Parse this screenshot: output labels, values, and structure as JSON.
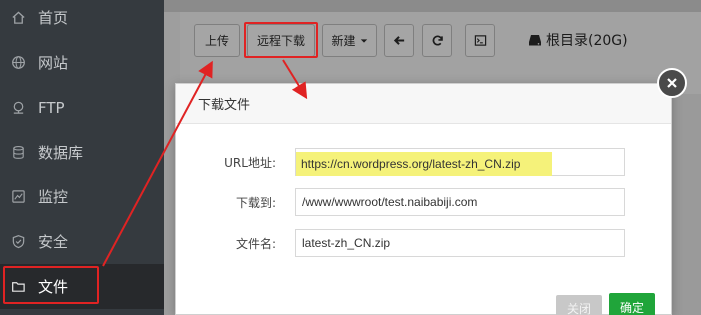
{
  "sidebar": {
    "items": [
      {
        "label": "首页",
        "icon": "home-icon"
      },
      {
        "label": "网站",
        "icon": "globe-icon"
      },
      {
        "label": "FTP",
        "icon": "ftp-icon"
      },
      {
        "label": "数据库",
        "icon": "database-icon"
      },
      {
        "label": "监控",
        "icon": "monitor-icon"
      },
      {
        "label": "安全",
        "icon": "shield-icon"
      },
      {
        "label": "文件",
        "icon": "folder-icon",
        "active": true
      }
    ]
  },
  "toolbar": {
    "upload_label": "上传",
    "remote_download_label": "远程下载",
    "new_label": "新建",
    "root_label": "根目录(20G)"
  },
  "dialog": {
    "title": "下载文件",
    "url_label": "URL地址:",
    "url_value": "https://cn.wordpress.org/latest-zh_CN.zip",
    "download_to_label": "下载到:",
    "download_to_value": "/www/wwwroot/test.naibabiji.com",
    "filename_label": "文件名:",
    "filename_value": "latest-zh_CN.zip",
    "close_label": "关闭",
    "ok_label": "确定"
  },
  "colors": {
    "sidebar_bg": "#353a3f",
    "annotation_red": "#e02323",
    "url_highlight": "#f5f27a",
    "confirm_green": "#20a53a"
  }
}
